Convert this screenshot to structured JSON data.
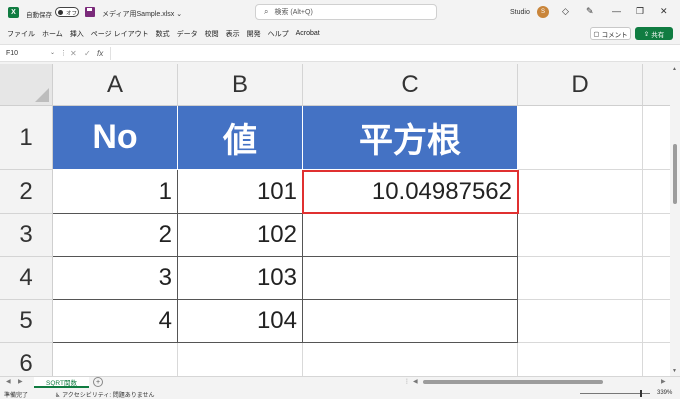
{
  "titlebar": {
    "autosave_label": "自動保存",
    "autosave_state": "オフ",
    "filename": "メディア用Sample.xlsx ⌄",
    "search_placeholder": "検索 (Alt+Q)",
    "user_name": "Studio",
    "avatar_initial": "S"
  },
  "menu": {
    "items": [
      "ファイル",
      "ホーム",
      "挿入",
      "ページ レイアウト",
      "数式",
      "データ",
      "校閲",
      "表示",
      "開発",
      "ヘルプ",
      "Acrobat"
    ],
    "comment_label": "コメント",
    "share_label": "共有"
  },
  "formula_bar": {
    "name_box": "F10",
    "fx_label": "fx",
    "formula": ""
  },
  "columns": [
    "A",
    "B",
    "C",
    "D"
  ],
  "rows": [
    "1",
    "2",
    "3",
    "4",
    "5",
    "6"
  ],
  "table": {
    "headers": [
      "No",
      "値",
      "平方根"
    ],
    "data": [
      [
        "1",
        "101",
        "10.04987562"
      ],
      [
        "2",
        "102",
        ""
      ],
      [
        "3",
        "103",
        ""
      ],
      [
        "4",
        "104",
        ""
      ]
    ],
    "header_color": "#4472c4",
    "selected_border_color": "#e03030"
  },
  "sheet_tabs": {
    "active": "SQRT関数"
  },
  "statusbar": {
    "ready": "準備完了",
    "accessibility": "アクセシビリティ: 問題ありません",
    "zoom": "339%"
  }
}
